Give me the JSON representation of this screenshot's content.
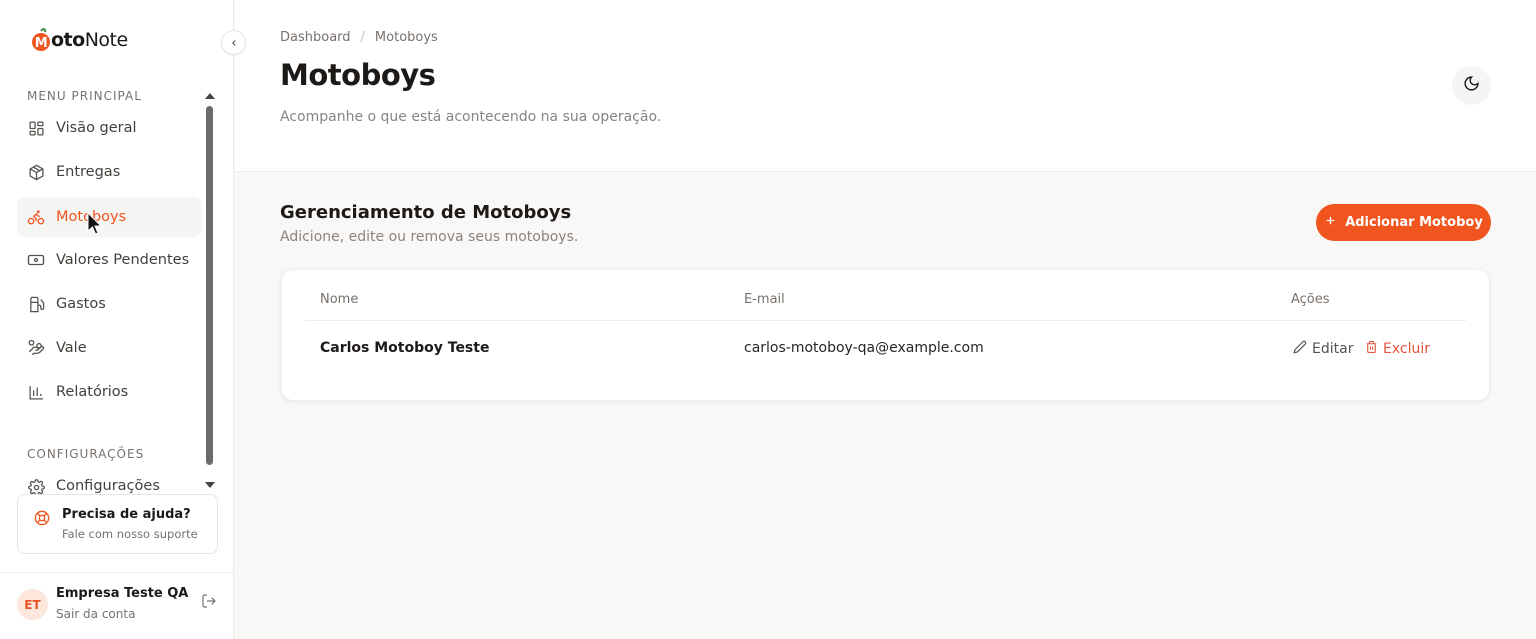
{
  "brand": {
    "logo_bold": "oto",
    "logo_light": "Note",
    "logo_letter": "M",
    "accent": "#f0541f"
  },
  "sidebar": {
    "main_section": "MENU PRINCIPAL",
    "items": [
      {
        "label": "Visão geral",
        "icon": "dashboard-icon"
      },
      {
        "label": "Entregas",
        "icon": "package-icon"
      },
      {
        "label": "Motoboys",
        "icon": "bike-icon",
        "active": true
      },
      {
        "label": "Valores Pendentes",
        "icon": "banknote-icon"
      },
      {
        "label": "Gastos",
        "icon": "fuel-icon"
      },
      {
        "label": "Vale",
        "icon": "hand-coins-icon"
      },
      {
        "label": "Relatórios",
        "icon": "bar-chart-icon"
      }
    ],
    "config_section": "CONFIGURAÇÕES",
    "config_items": [
      {
        "label": "Configurações",
        "icon": "gear-icon"
      }
    ],
    "help": {
      "title": "Precisa de ajuda?",
      "subtitle": "Fale com nosso suporte"
    },
    "user": {
      "initials": "ET",
      "name": "Empresa Teste QA",
      "action": "Sair da conta"
    }
  },
  "header": {
    "breadcrumb": [
      "Dashboard",
      "Motoboys"
    ],
    "title": "Motoboys",
    "subtitle": "Acompanhe o que está acontecendo na sua operação."
  },
  "section": {
    "title": "Gerenciamento de Motoboys",
    "subtitle": "Adicione, edite ou remova seus motoboys.",
    "add_button": "Adicionar Motoboy"
  },
  "table": {
    "columns": [
      "Nome",
      "E-mail",
      "Ações"
    ],
    "rows": [
      {
        "name": "Carlos Motoboy Teste",
        "email": "carlos-motoboy-qa@example.com",
        "edit": "Editar",
        "delete": "Excluir"
      }
    ]
  }
}
